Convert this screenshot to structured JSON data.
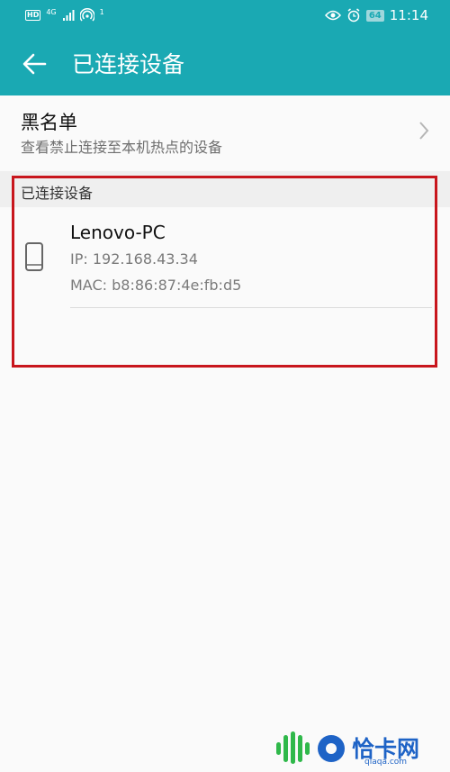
{
  "status_bar": {
    "hd_label": "HD",
    "network_type": "4G",
    "hotspot_count": "1",
    "battery": "64",
    "time": "11:14",
    "icons": [
      "signal-icon",
      "hotspot-icon",
      "eye-icon",
      "alarm-icon",
      "battery-icon"
    ]
  },
  "app_bar": {
    "title": "已连接设备"
  },
  "blacklist": {
    "title": "黑名单",
    "subtitle": "查看禁止连接至本机热点的设备"
  },
  "section": {
    "header": "已连接设备"
  },
  "devices": [
    {
      "name": "Lenovo-PC",
      "ip": "IP: 192.168.43.34",
      "mac": "MAC: b8:86:87:4e:fb:d5"
    }
  ],
  "watermark": {
    "name": "恰卡网",
    "url": "qiaqa.com"
  },
  "colors": {
    "accent": "#1aa9b3",
    "highlight": "#c8161d",
    "watermark": "#1e63c6"
  }
}
